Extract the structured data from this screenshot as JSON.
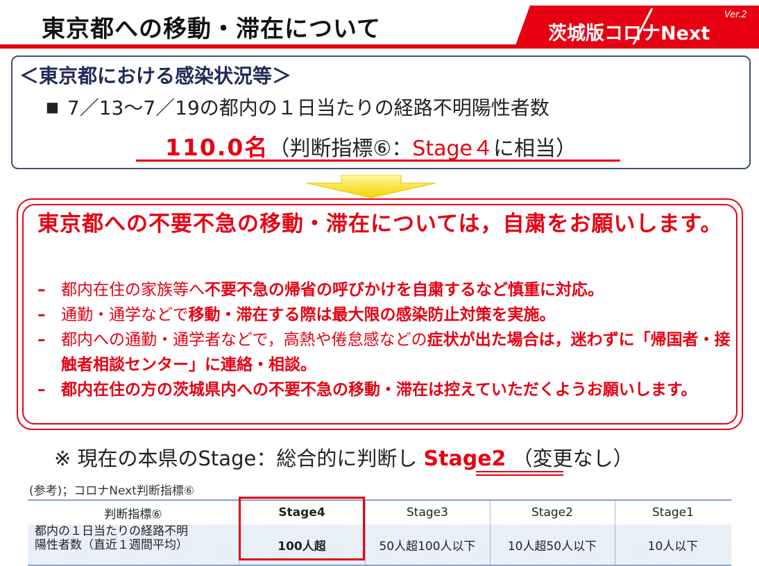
{
  "header": {
    "title": "東京都への移動・滞在について",
    "badge_text": "茨城版コロナNext",
    "badge_version": "Ver.2",
    "accent_color": "#e60012"
  },
  "status_box": {
    "heading": "＜東京都における感染状況等＞",
    "bullet": "7／13～7／19の都内の１日当たりの経路不明陽性者数",
    "value": "110.0名",
    "indicator_open": "（判断指標⑥：",
    "stage_text": "Stage４",
    "indicator_close": "に相当）"
  },
  "request_box": {
    "heading": "東京都への不要不急の移動・滞在については，自粛をお願いします。",
    "items": [
      {
        "plain": "都内在住の家族等へ",
        "bold": "不要不急の帰省の呼びかけを自粛するなど慎重に対応。",
        "plain2": ""
      },
      {
        "plain": "通勤・通学などで",
        "bold": "移動・滞在する際は最大限の感染防止対策を実施。",
        "plain2": ""
      },
      {
        "plain": "都内への通勤・通学者などで，高熱や倦怠感などの",
        "bold": "症状が出た場合は，迷わずに「帰国者・接触者相談センター」に連絡・相談。",
        "plain2": ""
      },
      {
        "plain": "",
        "bold": "都内在住の方の茨城県内への不要不急の移動・滞在は控えていただくようお願いします。",
        "plain2": ""
      }
    ]
  },
  "note": {
    "prefix": "※ 現在の本県のStage：総合的に判断し",
    "stage": "Stage2",
    "suffix": "（変更なし）"
  },
  "reference": {
    "caption": "(参考)；コロナNext判断指標⑥",
    "headers": [
      "判断指標⑥",
      "Stage4",
      "Stage3",
      "Stage2",
      "Stage1"
    ],
    "row_label_line1": "都内の１日当たりの経路不明",
    "row_label_line2": "陽性者数（直近１週間平均）",
    "values": [
      "100人超",
      "50人超100人以下",
      "10人超50人以下",
      "10人以下"
    ]
  }
}
